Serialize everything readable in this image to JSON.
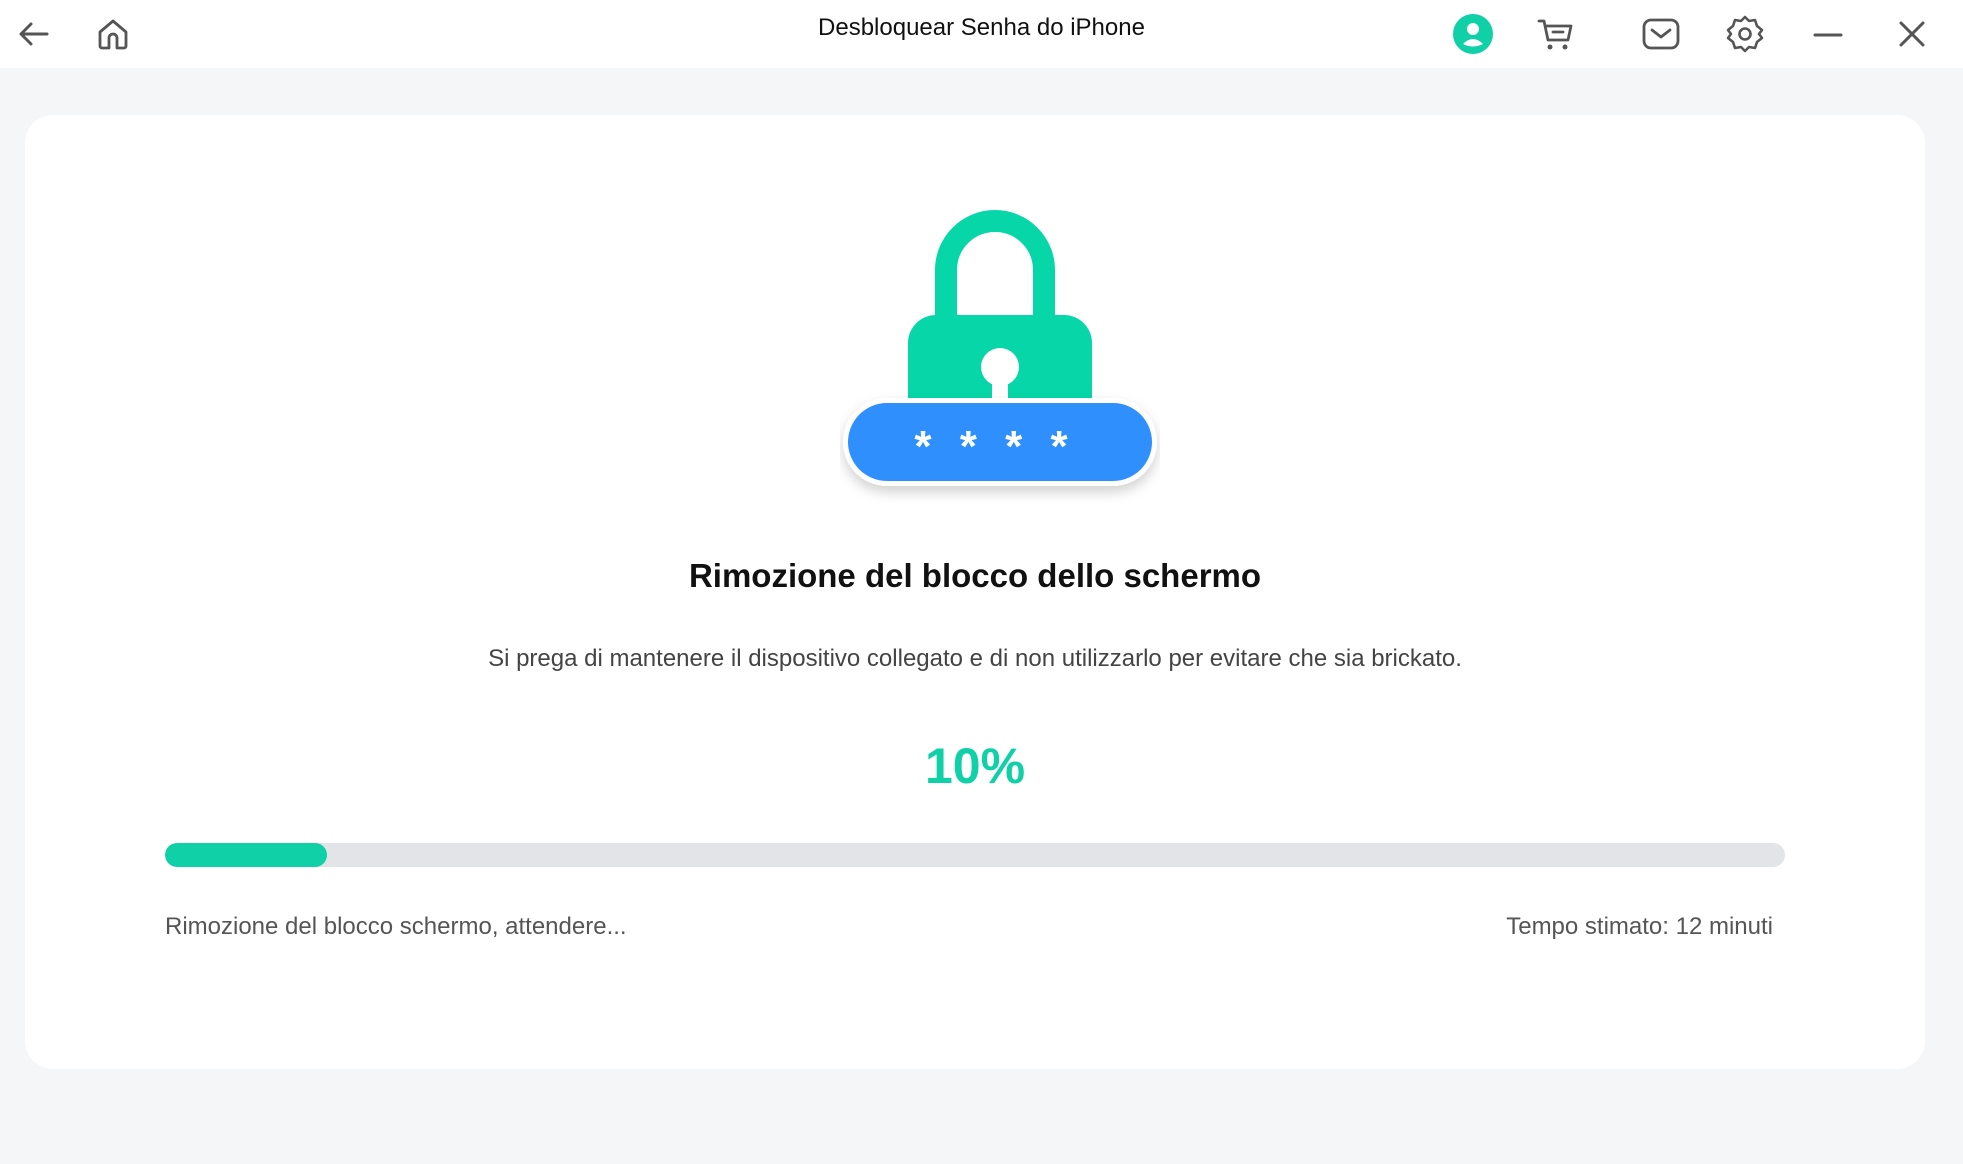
{
  "window": {
    "title": "Desbloquear Senha do iPhone"
  },
  "toolbar": {
    "icons": [
      "back-arrow-icon",
      "home-icon",
      "user-account-icon",
      "cart-icon",
      "mail-icon",
      "settings-gear-icon",
      "minimize-icon",
      "close-icon"
    ]
  },
  "colors": {
    "accent": "#0fd0a6",
    "lock_body": "#06d6a8",
    "password_pill": "#2f8ffd",
    "progress_track": "#e3e4e7",
    "background": "#f5f6f8"
  },
  "illustration": {
    "icon": "padlock-password-icon",
    "mask": "* * * *"
  },
  "main": {
    "heading": "Rimozione del blocco dello schermo",
    "description": "Si prega di mantenere il dispositivo collegato e di non utilizzarlo per evitare che sia brickato.",
    "percent_label": "10%",
    "progress_fraction": 0.1,
    "status_text": "Rimozione del blocco schermo, attendere...",
    "estimated_time": "Tempo stimato: 12 minuti"
  }
}
